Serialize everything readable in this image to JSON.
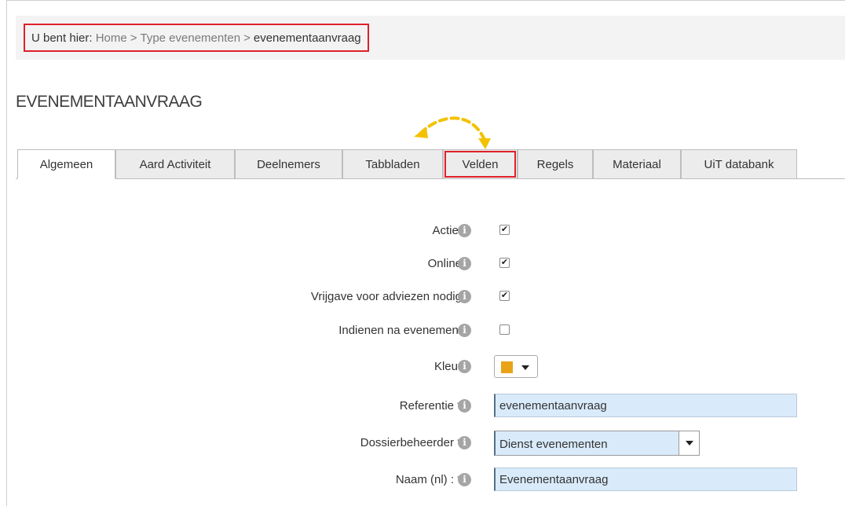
{
  "breadcrumb": {
    "prefix": "U bent hier:",
    "items": [
      "Home",
      "Type evenementen",
      "evenementaanvraag"
    ],
    "separator": ">"
  },
  "page_title": "EVENEMENTAANVRAAG",
  "tabs": [
    {
      "label": "Algemeen",
      "active": true
    },
    {
      "label": "Aard Activiteit"
    },
    {
      "label": "Deelnemers"
    },
    {
      "label": "Tabbladen"
    },
    {
      "label": "Velden",
      "highlighted": true
    },
    {
      "label": "Regels"
    },
    {
      "label": "Materiaal"
    },
    {
      "label": "UiT databank"
    }
  ],
  "form": {
    "actief": {
      "label": "Actief",
      "checked": true
    },
    "online": {
      "label": "Online",
      "checked": true
    },
    "vrijgave": {
      "label": "Vrijgave voor adviezen nodig",
      "checked": true
    },
    "indienen": {
      "label": "Indienen na evenement",
      "checked": false
    },
    "kleur": {
      "label": "Kleur",
      "color": "#e8a317"
    },
    "referentie": {
      "label": "Referentie *",
      "value": "evenementaanvraag"
    },
    "dossierbeheerder": {
      "label": "Dossierbeheerder *",
      "value": "Dienst evenementen"
    },
    "naam": {
      "label": "Naam (nl) : *",
      "value": "Evenementaanvraag"
    }
  },
  "icons": {
    "info": "info-icon",
    "check": "✔"
  },
  "colors": {
    "highlight": "#e0202a",
    "input_bg": "#d9ebfb",
    "arrow": "#f2c200"
  }
}
